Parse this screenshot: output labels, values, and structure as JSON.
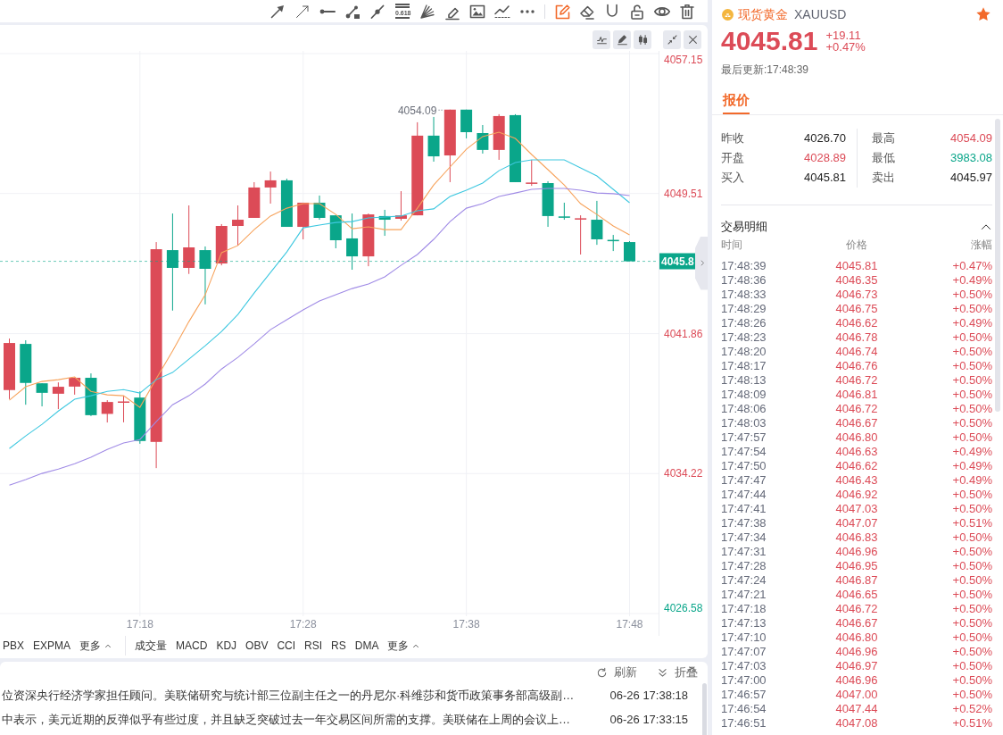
{
  "toolbar": {
    "drawing_tools": [
      {
        "kind": "arrow",
        "active": false
      },
      {
        "kind": "thin-arrow",
        "active": false
      },
      {
        "kind": "horizontal-line",
        "active": false
      },
      {
        "kind": "segment",
        "active": false
      },
      {
        "kind": "ray",
        "active": false
      },
      {
        "kind": "fibonacci",
        "label": "0.618",
        "active": false
      },
      {
        "kind": "fan",
        "active": false
      },
      {
        "kind": "highlighter",
        "active": false
      },
      {
        "kind": "image",
        "active": false
      },
      {
        "kind": "trend",
        "active": false
      },
      {
        "kind": "more",
        "active": false
      }
    ],
    "edit_tools": [
      {
        "kind": "draw-mode",
        "active": true
      },
      {
        "kind": "eraser",
        "active": false
      },
      {
        "kind": "magnet",
        "active": false
      },
      {
        "kind": "lock",
        "active": false
      },
      {
        "kind": "visibility",
        "active": false
      },
      {
        "kind": "delete",
        "active": false
      }
    ]
  },
  "chart_panel": {
    "buttons": [
      {
        "kind": "indicator"
      },
      {
        "kind": "draw"
      },
      {
        "kind": "chart-type"
      },
      {
        "kind": "shrink"
      },
      {
        "kind": "close"
      }
    ],
    "chart_data": [
      {
        "type": "candlestick",
        "categories": [
          null,
          null,
          null,
          null,
          null,
          null,
          null,
          null,
          "17:18",
          null,
          null,
          null,
          null,
          null,
          null,
          null,
          null,
          null,
          "17:28",
          null,
          null,
          null,
          null,
          null,
          null,
          null,
          null,
          null,
          "17:38",
          null,
          null,
          null,
          null,
          null,
          null,
          null,
          null,
          null,
          "17:48"
        ],
        "ohlc": [
          [
            4038.78,
            4041.59,
            4038.29,
            4041.35
          ],
          [
            4041.3,
            4041.5,
            4037.98,
            4039.17
          ],
          [
            4039.15,
            4039.15,
            4037.89,
            4038.63
          ],
          [
            4038.58,
            4039.2,
            4037.74,
            4038.96
          ],
          [
            4038.97,
            4039.45,
            4038.53,
            4039.45
          ],
          [
            4039.45,
            4039.69,
            4037.36,
            4037.41
          ],
          [
            4037.48,
            4038.23,
            4037.01,
            4038.13
          ],
          [
            4038.14,
            4038.47,
            4037.02,
            4038.16
          ],
          [
            4038.37,
            4038.71,
            4035.85,
            4036.0
          ],
          [
            4035.95,
            4046.86,
            4034.52,
            4046.47
          ],
          [
            4046.42,
            4048.42,
            4043.12,
            4045.45
          ],
          [
            4045.45,
            4048.86,
            4045.12,
            4046.57
          ],
          [
            4046.42,
            4046.62,
            4043.46,
            4045.4
          ],
          [
            4045.69,
            4047.84,
            4045.59,
            4047.74
          ],
          [
            4047.74,
            4048.86,
            4046.67,
            4048.08
          ],
          [
            4048.18,
            4050.13,
            4048.18,
            4049.84
          ],
          [
            4049.84,
            4050.71,
            4048.96,
            4050.23
          ],
          [
            4050.23,
            4050.32,
            4047.69,
            4047.69
          ],
          [
            4047.69,
            4049.01,
            4047.01,
            4049.01
          ],
          [
            4049.01,
            4049.4,
            4048.08,
            4048.18
          ],
          [
            4048.32,
            4048.32,
            4046.52,
            4046.96
          ],
          [
            4047.06,
            4048.42,
            4045.35,
            4046.08
          ],
          [
            4046.08,
            4048.42,
            4045.54,
            4048.37
          ],
          [
            4048.28,
            4048.62,
            4047.2,
            4048.08
          ],
          [
            4048.13,
            4049.64,
            4048.03,
            4048.32
          ],
          [
            4048.32,
            4053.4,
            4048.32,
            4052.67
          ],
          [
            4052.67,
            4053.69,
            4051.25,
            4051.54
          ],
          [
            4051.59,
            4054.09,
            4050.13,
            4054.09
          ],
          [
            4054.09,
            4054.09,
            4052.52,
            4052.86
          ],
          [
            4052.81,
            4053.25,
            4051.69,
            4051.89
          ],
          [
            4051.89,
            4053.84,
            4051.35,
            4053.74
          ],
          [
            4053.79,
            4053.84,
            4050.13,
            4050.13
          ],
          [
            4050.09,
            4051.35,
            4049.93,
            4050.11
          ],
          [
            4050.08,
            4050.18,
            4047.69,
            4048.28
          ],
          [
            4048.26,
            4049.01,
            4048.08,
            4048.24
          ],
          [
            4048.14,
            4048.32,
            4046.18,
            4048.16
          ],
          [
            4048.08,
            4049.11,
            4046.71,
            4047.01
          ],
          [
            4046.98,
            4047.25,
            4046.37,
            4046.96
          ],
          [
            4046.86,
            4046.91,
            4045.81,
            4045.81
          ]
        ],
        "series": [
          {
            "type": "line",
            "color": "#f7a35c",
            "values": [
              4038.23,
              4038.96,
              4039.25,
              4039.35,
              4039.5,
              4038.71,
              4038.52,
              4038.47,
              4037.84,
              4039.4,
              4040.91,
              4042.52,
              4043.98,
              4046.28,
              4046.67,
              4047.54,
              4048.28,
              4048.71,
              4048.96,
              4048.96,
              4048.37,
              4047.59,
              4047.69,
              4047.54,
              4047.54,
              4048.71,
              4049.98,
              4050.96,
              4051.93,
              4052.62,
              4052.86,
              4052.52,
              4051.64,
              4050.81,
              4049.98,
              4048.96,
              4048.37,
              4047.74,
              4047.25
            ]
          },
          {
            "type": "line",
            "color": "#3fc8e0",
            "values": [
              4035.59,
              4036.28,
              4036.91,
              4037.64,
              4038.28,
              4038.47,
              4038.71,
              4038.81,
              4038.62,
              4039.35,
              4039.74,
              4040.47,
              4041.2,
              4041.98,
              4042.91,
              4044.08,
              4045.2,
              4046.32,
              4047.64,
              4047.79,
              4047.93,
              4047.98,
              4048.18,
              4048.23,
              4048.28,
              4048.57,
              4048.67,
              4049.35,
              4049.69,
              4050.08,
              4050.76,
              4051.2,
              4051.35,
              4051.35,
              4051.35,
              4050.91,
              4050.47,
              4049.74,
              4049.01
            ]
          },
          {
            "type": "line",
            "color": "#a08be6",
            "values": [
              4033.59,
              4033.89,
              4034.23,
              4034.47,
              4034.76,
              4035.11,
              4035.54,
              4035.89,
              4036.08,
              4037.06,
              4037.98,
              4038.47,
              4039.11,
              4039.93,
              4040.57,
              4041.3,
              4042.08,
              4042.62,
              4043.15,
              4043.64,
              4043.98,
              4044.32,
              4044.57,
              4044.96,
              4045.59,
              4046.18,
              4047.01,
              4047.98,
              4048.71,
              4048.96,
              4049.35,
              4049.54,
              4049.74,
              4049.79,
              4049.79,
              4049.69,
              4049.54,
              4049.5,
              4049.4
            ]
          }
        ],
        "ylim": [
          4026.58,
          4057.15
        ],
        "yticks": [
          4057.15,
          4049.51,
          4041.86,
          4034.22,
          4026.58
        ],
        "ref_lines": [
          {
            "axis": "y",
            "value": 4045.81,
            "label": "4045.8",
            "color": "#0aa68a",
            "line_style": "dashed"
          }
        ],
        "annotations": [
          "4054.09"
        ],
        "grid": true
      }
    ],
    "main_indicators": [
      {
        "kind": "tab",
        "label": "PBX"
      },
      {
        "kind": "tab",
        "label": "EXPMA"
      },
      {
        "kind": "more",
        "label": "更多"
      }
    ],
    "sub_indicators": [
      {
        "kind": "tab",
        "label": "成交量"
      },
      {
        "kind": "tab",
        "label": "MACD"
      },
      {
        "kind": "tab",
        "label": "KDJ"
      },
      {
        "kind": "tab",
        "label": "OBV"
      },
      {
        "kind": "tab",
        "label": "CCI"
      },
      {
        "kind": "tab",
        "label": "RSI"
      },
      {
        "kind": "tab",
        "label": "RS"
      },
      {
        "kind": "tab",
        "label": "DMA"
      },
      {
        "kind": "more",
        "label": "更多"
      }
    ]
  },
  "news": {
    "actions": [
      {
        "kind": "refresh",
        "label": "刷新"
      },
      {
        "kind": "collapse",
        "label": "折叠"
      }
    ],
    "items": [
      {
        "text": "位资深央行经济学家担任顾问。美联储研究与统计部三位副主任之一的丹尼尔·科维莎和货币政策事务部高级副…",
        "time": "06-26 17:38:18"
      },
      {
        "text": "中表示，美元近期的反弹似乎有些过度，并且缺乏突破过去一年交易区间所需的支撑。美联储在上周的会议上…",
        "time": "06-26 17:33:15"
      }
    ]
  },
  "quote": {
    "name": "现货黄金",
    "symbol": "XAUUSD",
    "favorite": true,
    "price": "4045.81",
    "change": "+19.11",
    "change_percent": "+0.47%",
    "updated": "最后更新:17:48:39",
    "tabs": [
      {
        "label": "报价",
        "selected": true
      }
    ],
    "stats": [
      {
        "label": "昨收",
        "value": "4026.70"
      },
      {
        "label": "最高",
        "value": "4054.09",
        "color": "#dc4b57"
      },
      {
        "label": "开盘",
        "value": "4028.89",
        "color": "#dc4b57"
      },
      {
        "label": "最低",
        "value": "3983.08",
        "color": "#0aa68a"
      },
      {
        "label": "买入",
        "value": "4045.81"
      },
      {
        "label": "卖出",
        "value": "4045.97"
      }
    ],
    "trades": {
      "title": "交易明细",
      "expanded": true,
      "columns": [
        "时间",
        "价格",
        "涨幅"
      ],
      "rows": [
        {
          "time": "17:48:39",
          "price": "4045.81",
          "change": "+0.47%"
        },
        {
          "time": "17:48:36",
          "price": "4046.35",
          "change": "+0.49%"
        },
        {
          "time": "17:48:33",
          "price": "4046.73",
          "change": "+0.50%"
        },
        {
          "time": "17:48:29",
          "price": "4046.75",
          "change": "+0.50%"
        },
        {
          "time": "17:48:26",
          "price": "4046.62",
          "change": "+0.49%"
        },
        {
          "time": "17:48:23",
          "price": "4046.78",
          "change": "+0.50%"
        },
        {
          "time": "17:48:20",
          "price": "4046.74",
          "change": "+0.50%"
        },
        {
          "time": "17:48:17",
          "price": "4046.76",
          "change": "+0.50%"
        },
        {
          "time": "17:48:13",
          "price": "4046.72",
          "change": "+0.50%"
        },
        {
          "time": "17:48:09",
          "price": "4046.81",
          "change": "+0.50%"
        },
        {
          "time": "17:48:06",
          "price": "4046.72",
          "change": "+0.50%"
        },
        {
          "time": "17:48:03",
          "price": "4046.67",
          "change": "+0.50%"
        },
        {
          "time": "17:47:57",
          "price": "4046.80",
          "change": "+0.50%"
        },
        {
          "time": "17:47:54",
          "price": "4046.63",
          "change": "+0.49%"
        },
        {
          "time": "17:47:50",
          "price": "4046.62",
          "change": "+0.49%"
        },
        {
          "time": "17:47:47",
          "price": "4046.43",
          "change": "+0.49%"
        },
        {
          "time": "17:47:44",
          "price": "4046.92",
          "change": "+0.50%"
        },
        {
          "time": "17:47:41",
          "price": "4047.03",
          "change": "+0.50%"
        },
        {
          "time": "17:47:38",
          "price": "4047.07",
          "change": "+0.51%"
        },
        {
          "time": "17:47:34",
          "price": "4046.83",
          "change": "+0.50%"
        },
        {
          "time": "17:47:31",
          "price": "4046.96",
          "change": "+0.50%"
        },
        {
          "time": "17:47:28",
          "price": "4046.95",
          "change": "+0.50%"
        },
        {
          "time": "17:47:24",
          "price": "4046.87",
          "change": "+0.50%"
        },
        {
          "time": "17:47:21",
          "price": "4046.65",
          "change": "+0.50%"
        },
        {
          "time": "17:47:18",
          "price": "4046.72",
          "change": "+0.50%"
        },
        {
          "time": "17:47:13",
          "price": "4046.67",
          "change": "+0.50%"
        },
        {
          "time": "17:47:10",
          "price": "4046.80",
          "change": "+0.50%"
        },
        {
          "time": "17:47:07",
          "price": "4046.96",
          "change": "+0.50%"
        },
        {
          "time": "17:47:03",
          "price": "4046.97",
          "change": "+0.50%"
        },
        {
          "time": "17:47:00",
          "price": "4046.96",
          "change": "+0.50%"
        },
        {
          "time": "17:46:57",
          "price": "4047.00",
          "change": "+0.50%"
        },
        {
          "time": "17:46:54",
          "price": "4047.44",
          "change": "+0.52%"
        },
        {
          "time": "17:46:51",
          "price": "4047.08",
          "change": "+0.51%"
        }
      ]
    }
  }
}
